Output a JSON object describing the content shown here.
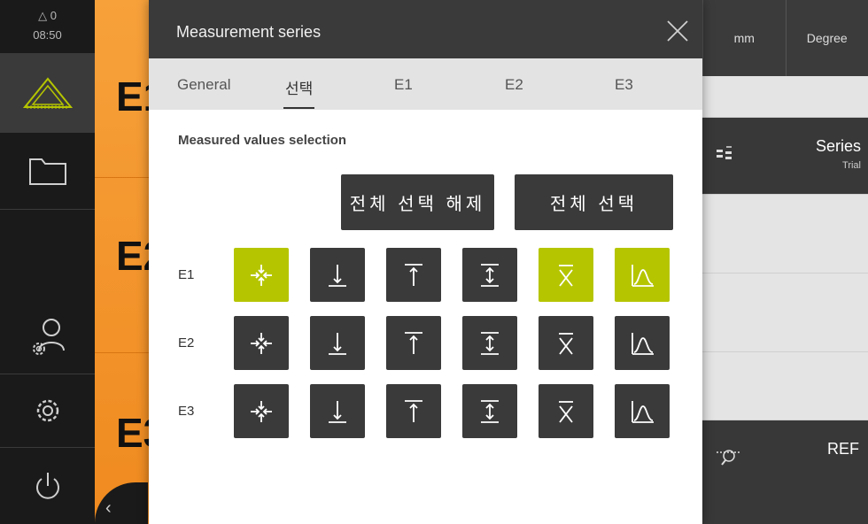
{
  "status": {
    "warnings": "0",
    "time": "08:50"
  },
  "background_list": {
    "items": [
      "E1",
      "E2",
      "E3"
    ]
  },
  "right_panel": {
    "unit_length": "mm",
    "unit_angle": "Degree",
    "series_label": "Series",
    "series_sub": "Trial",
    "ref_label": "REF"
  },
  "dialog": {
    "title": "Measurement series",
    "tabs": [
      "General",
      "선택",
      "E1",
      "E2",
      "E3"
    ],
    "active_tab": 1,
    "section_title": "Measured values selection",
    "deselect_all": "전체 선택 해제",
    "select_all": "전체 선택",
    "rows": [
      {
        "label": "E1",
        "selected": [
          true,
          false,
          false,
          false,
          true,
          true
        ]
      },
      {
        "label": "E2",
        "selected": [
          false,
          false,
          false,
          false,
          false,
          false
        ]
      },
      {
        "label": "E3",
        "selected": [
          false,
          false,
          false,
          false,
          false,
          false
        ]
      }
    ],
    "value_types": [
      "position",
      "minimum",
      "maximum",
      "range",
      "mean",
      "distribution"
    ]
  },
  "colors": {
    "accent": "#b5c500",
    "orange": "#f29222",
    "dark": "#3a3a3a"
  }
}
